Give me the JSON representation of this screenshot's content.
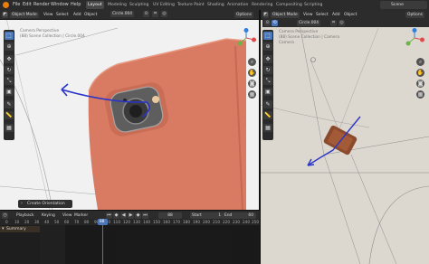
{
  "menu": {
    "items": [
      "File",
      "Edit",
      "Render",
      "Window",
      "Help"
    ],
    "workspaces": [
      "Layout",
      "Modeling",
      "Sculpting",
      "UV Editing",
      "Texture Paint",
      "Shading",
      "Animation",
      "Rendering",
      "Compositing",
      "Scripting"
    ],
    "active_workspace": "Layout",
    "scene_label": "Scene"
  },
  "left_viewport": {
    "mode": "Object Mode",
    "view": "View",
    "select": "Select",
    "add": "Add",
    "object": "Object",
    "object_name": "Circle.004",
    "options": "Options",
    "overlay_line1": "Camera Perspective",
    "overlay_line2": "(88) Scene Collection | Circle.004",
    "operator_panel": "Create Orientation"
  },
  "right_viewport": {
    "mode": "Object Mode",
    "view": "View",
    "select": "Select",
    "add": "Add",
    "object": "Object",
    "object_name": "Circle.004",
    "options": "Options",
    "overlay_line1": "Camera Perspective",
    "overlay_line2": "(88) Scene Collection | Camera",
    "overlay_line3": "Camera"
  },
  "timeline": {
    "playback": "Playback",
    "keying": "Keying",
    "view": "View",
    "marker": "Marker",
    "current_frame": "88",
    "start_label": "Start",
    "start_value": "1",
    "end_label": "End",
    "end_value": "60",
    "summary": "Summary",
    "ticks": [
      "0",
      "10",
      "20",
      "30",
      "40",
      "50",
      "60",
      "70",
      "80",
      "90",
      "100",
      "110",
      "120",
      "130",
      "140",
      "150",
      "160",
      "170",
      "180",
      "190",
      "200",
      "210",
      "220",
      "230",
      "240",
      "250"
    ]
  },
  "colors": {
    "phone_body": "#d97a62",
    "annotation_stroke": "#2a34c8",
    "accent": "#4b77b9",
    "playhead": "#4b77b9"
  }
}
